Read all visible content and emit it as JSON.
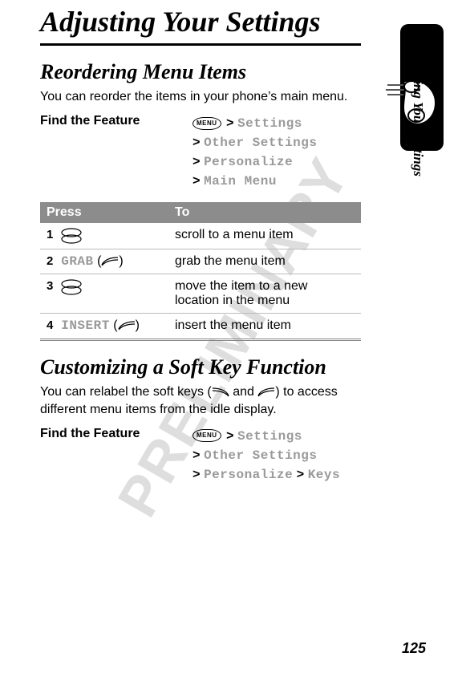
{
  "watermark": "PRELIMINARY",
  "chapter_title": "Adjusting Your Settings",
  "side_label": "Adjusting Your Settings",
  "section1": {
    "heading": "Reordering Menu Items",
    "body": "You can reorder the items in your phone’s main menu.",
    "feature_label": "Find the Feature",
    "menu_btn": "MENU",
    "gt": ">",
    "path": [
      "Settings",
      "Other Settings",
      "Personalize",
      "Main Menu"
    ]
  },
  "table1": {
    "head_press": "Press",
    "head_to": "To",
    "rows": [
      {
        "num": "1",
        "press_mono": "",
        "to": "scroll to a menu item"
      },
      {
        "num": "2",
        "press_mono": "GRAB",
        "to": "grab the menu item"
      },
      {
        "num": "3",
        "press_mono": "",
        "to": "move the item to a new location in the menu"
      },
      {
        "num": "4",
        "press_mono": "INSERT",
        "to": "insert the menu item"
      }
    ],
    "left_paren": "(",
    "right_paren": ")"
  },
  "section2": {
    "heading": "Customizing a Soft Key Function",
    "body_pre": "You can relabel the soft keys (",
    "body_mid": " and ",
    "body_post": ") to access different menu items from the idle display.",
    "feature_label": "Find the Feature",
    "menu_btn": "MENU",
    "gt": ">",
    "path_line1": "Settings",
    "path_line2": "Other Settings",
    "path_line3a": "Personalize",
    "path_line3b": "Keys"
  },
  "page_number": "125"
}
